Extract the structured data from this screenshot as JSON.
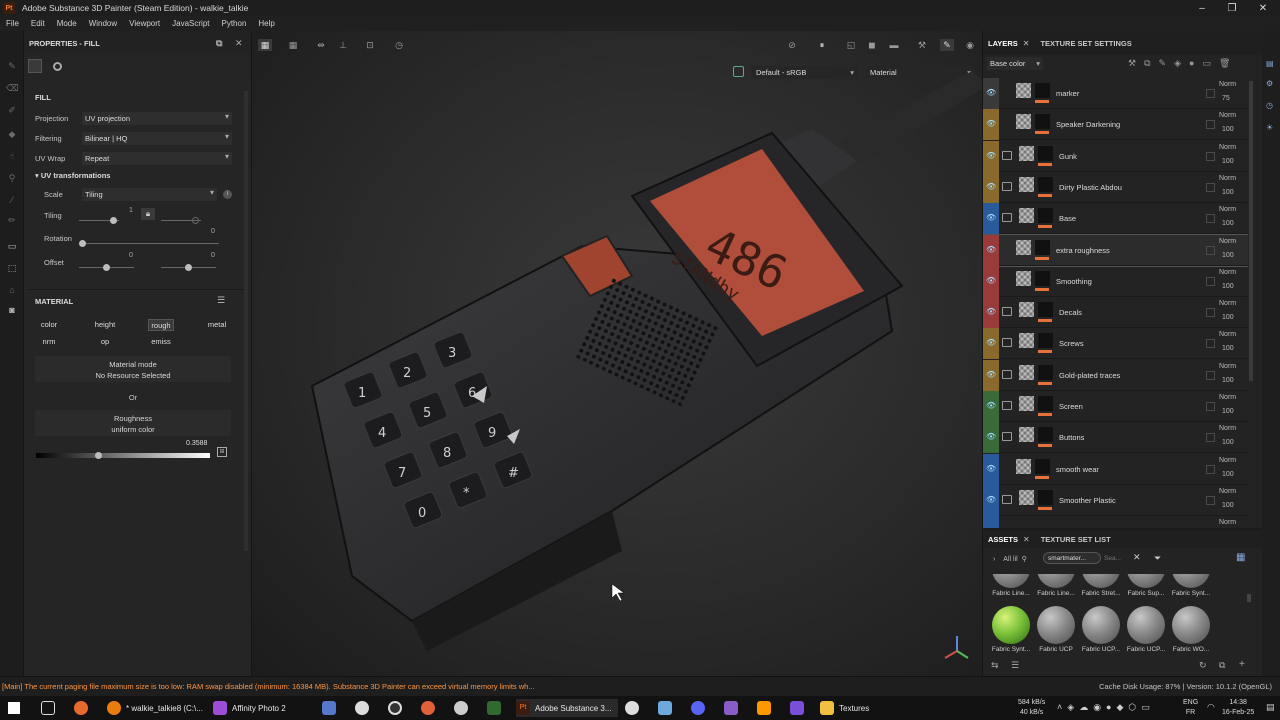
{
  "app": {
    "title": "Adobe Substance 3D Painter (Steam Edition) - walkie_talkie",
    "logo": "Pt"
  },
  "menu": [
    "File",
    "Edit",
    "Mode",
    "Window",
    "Viewport",
    "JavaScript",
    "Python",
    "Help"
  ],
  "props": {
    "title": "PROPERTIES - FILL",
    "section_fill": "FILL",
    "projection_label": "Projection",
    "projection_value": "UV projection",
    "filtering_label": "Filtering",
    "filtering_value": "Bilinear | HQ",
    "uvwrap_label": "UV Wrap",
    "uvwrap_value": "Repeat",
    "uvtrans_label": "UV transformations",
    "scale_label": "Scale",
    "scale_value": "Tiling",
    "tiling_label": "Tiling",
    "tiling_value": "1",
    "rotation_label": "Rotation",
    "rotation_value": "0",
    "offset_label": "Offset",
    "offset_x": "0",
    "offset_y": "0",
    "material_label": "MATERIAL",
    "channels_row1": [
      "color",
      "height",
      "rough",
      "metal"
    ],
    "channels_row2": [
      "nrm",
      "op",
      "emiss"
    ],
    "active_channel": "rough",
    "matmode_title": "Material mode",
    "matmode_value": "No Resource Selected",
    "or_label": "Or",
    "roughness_title": "Roughness",
    "roughness_value": "uniform color",
    "roughness_number": "0.3588",
    "roughness_fraction": 0.3588
  },
  "viewport": {
    "colorspace": "Default - sRGB",
    "mode": "Material",
    "device": {
      "display": "486",
      "display_sub": "STANdby",
      "keys": [
        "1",
        "2",
        "3",
        "4",
        "5",
        "6",
        "7",
        "8",
        "9",
        "0",
        "*",
        "#"
      ]
    }
  },
  "layers_panel": {
    "tab_layers": "LAYERS",
    "tab_tss": "TEXTURE SET SETTINGS",
    "channel": "Base color",
    "layers": [
      {
        "name": "marker",
        "blend": "Norm",
        "opacity": "75",
        "color": "#3a3a3a",
        "folder": false
      },
      {
        "name": "Speaker Darkening",
        "blend": "Norm",
        "opacity": "100",
        "color": "#8a6a2a",
        "folder": false
      },
      {
        "name": "Gunk",
        "blend": "Norm",
        "opacity": "100",
        "color": "#8a6a2a",
        "folder": true
      },
      {
        "name": "Dirty Plastic Abdou",
        "blend": "Norm",
        "opacity": "100",
        "color": "#8a6a2a",
        "folder": true
      },
      {
        "name": "Base",
        "blend": "Norm",
        "opacity": "100",
        "color": "#2a5a9a",
        "folder": true
      },
      {
        "name": "extra roughness",
        "blend": "Norm",
        "opacity": "100",
        "color": "#9a3a3a",
        "folder": false
      },
      {
        "name": "Smoothing",
        "blend": "Norm",
        "opacity": "100",
        "color": "#9a3a3a",
        "folder": false
      },
      {
        "name": "Decals",
        "blend": "Norm",
        "opacity": "100",
        "color": "#9a3a3a",
        "folder": true
      },
      {
        "name": "Screws",
        "blend": "Norm",
        "opacity": "100",
        "color": "#8a6a2a",
        "folder": true
      },
      {
        "name": "Gold-plated traces",
        "blend": "Norm",
        "opacity": "100",
        "color": "#8a6a2a",
        "folder": true
      },
      {
        "name": "Screen",
        "blend": "Norm",
        "opacity": "100",
        "color": "#3a6a3a",
        "folder": true
      },
      {
        "name": "Buttons",
        "blend": "Norm",
        "opacity": "100",
        "color": "#3a6a3a",
        "folder": true
      },
      {
        "name": "smooth wear",
        "blend": "Norm",
        "opacity": "100",
        "color": "#2a5a9a",
        "folder": false
      },
      {
        "name": "Smoother Plastic",
        "blend": "Norm",
        "opacity": "100",
        "color": "#2a5a9a",
        "folder": true
      }
    ],
    "partial_blend": "Norm"
  },
  "assets": {
    "tab_assets": "ASSETS",
    "tab_tsl": "TEXTURE SET LIST",
    "filter_all": "All lil",
    "filter_tag": "smartmater...",
    "search_placeholder": "Sea...",
    "row1": [
      "Fabric Line...",
      "Fabric Line...",
      "Fabric Stret...",
      "Fabric Sup...",
      "Fabric Synt..."
    ],
    "row2": [
      "Fabric Synt...",
      "Fabric UCP",
      "Fabric UCP...",
      "Fabric UCP...",
      "Fabric WO..."
    ]
  },
  "status": {
    "warning": "[Main] The current paging file maximum size is too low: RAM swap disabled (minimum: 16384 MB). Substance 3D Painter can exceed virtual memory limits wh...",
    "cache": "Cache Disk Usage:   87% | Version: 10.1.2 (OpenGL)"
  },
  "taskbar": {
    "items": [
      "* walkie_talkie8 (C:\\...",
      "Affinity Photo 2",
      "Adobe Substance 3...",
      "Textures"
    ],
    "net_up": "584 kB/s",
    "net_down": "40 kB/s",
    "lang": "ENG",
    "region": "FR",
    "time": "14:38",
    "date": "16-Feb-25"
  }
}
